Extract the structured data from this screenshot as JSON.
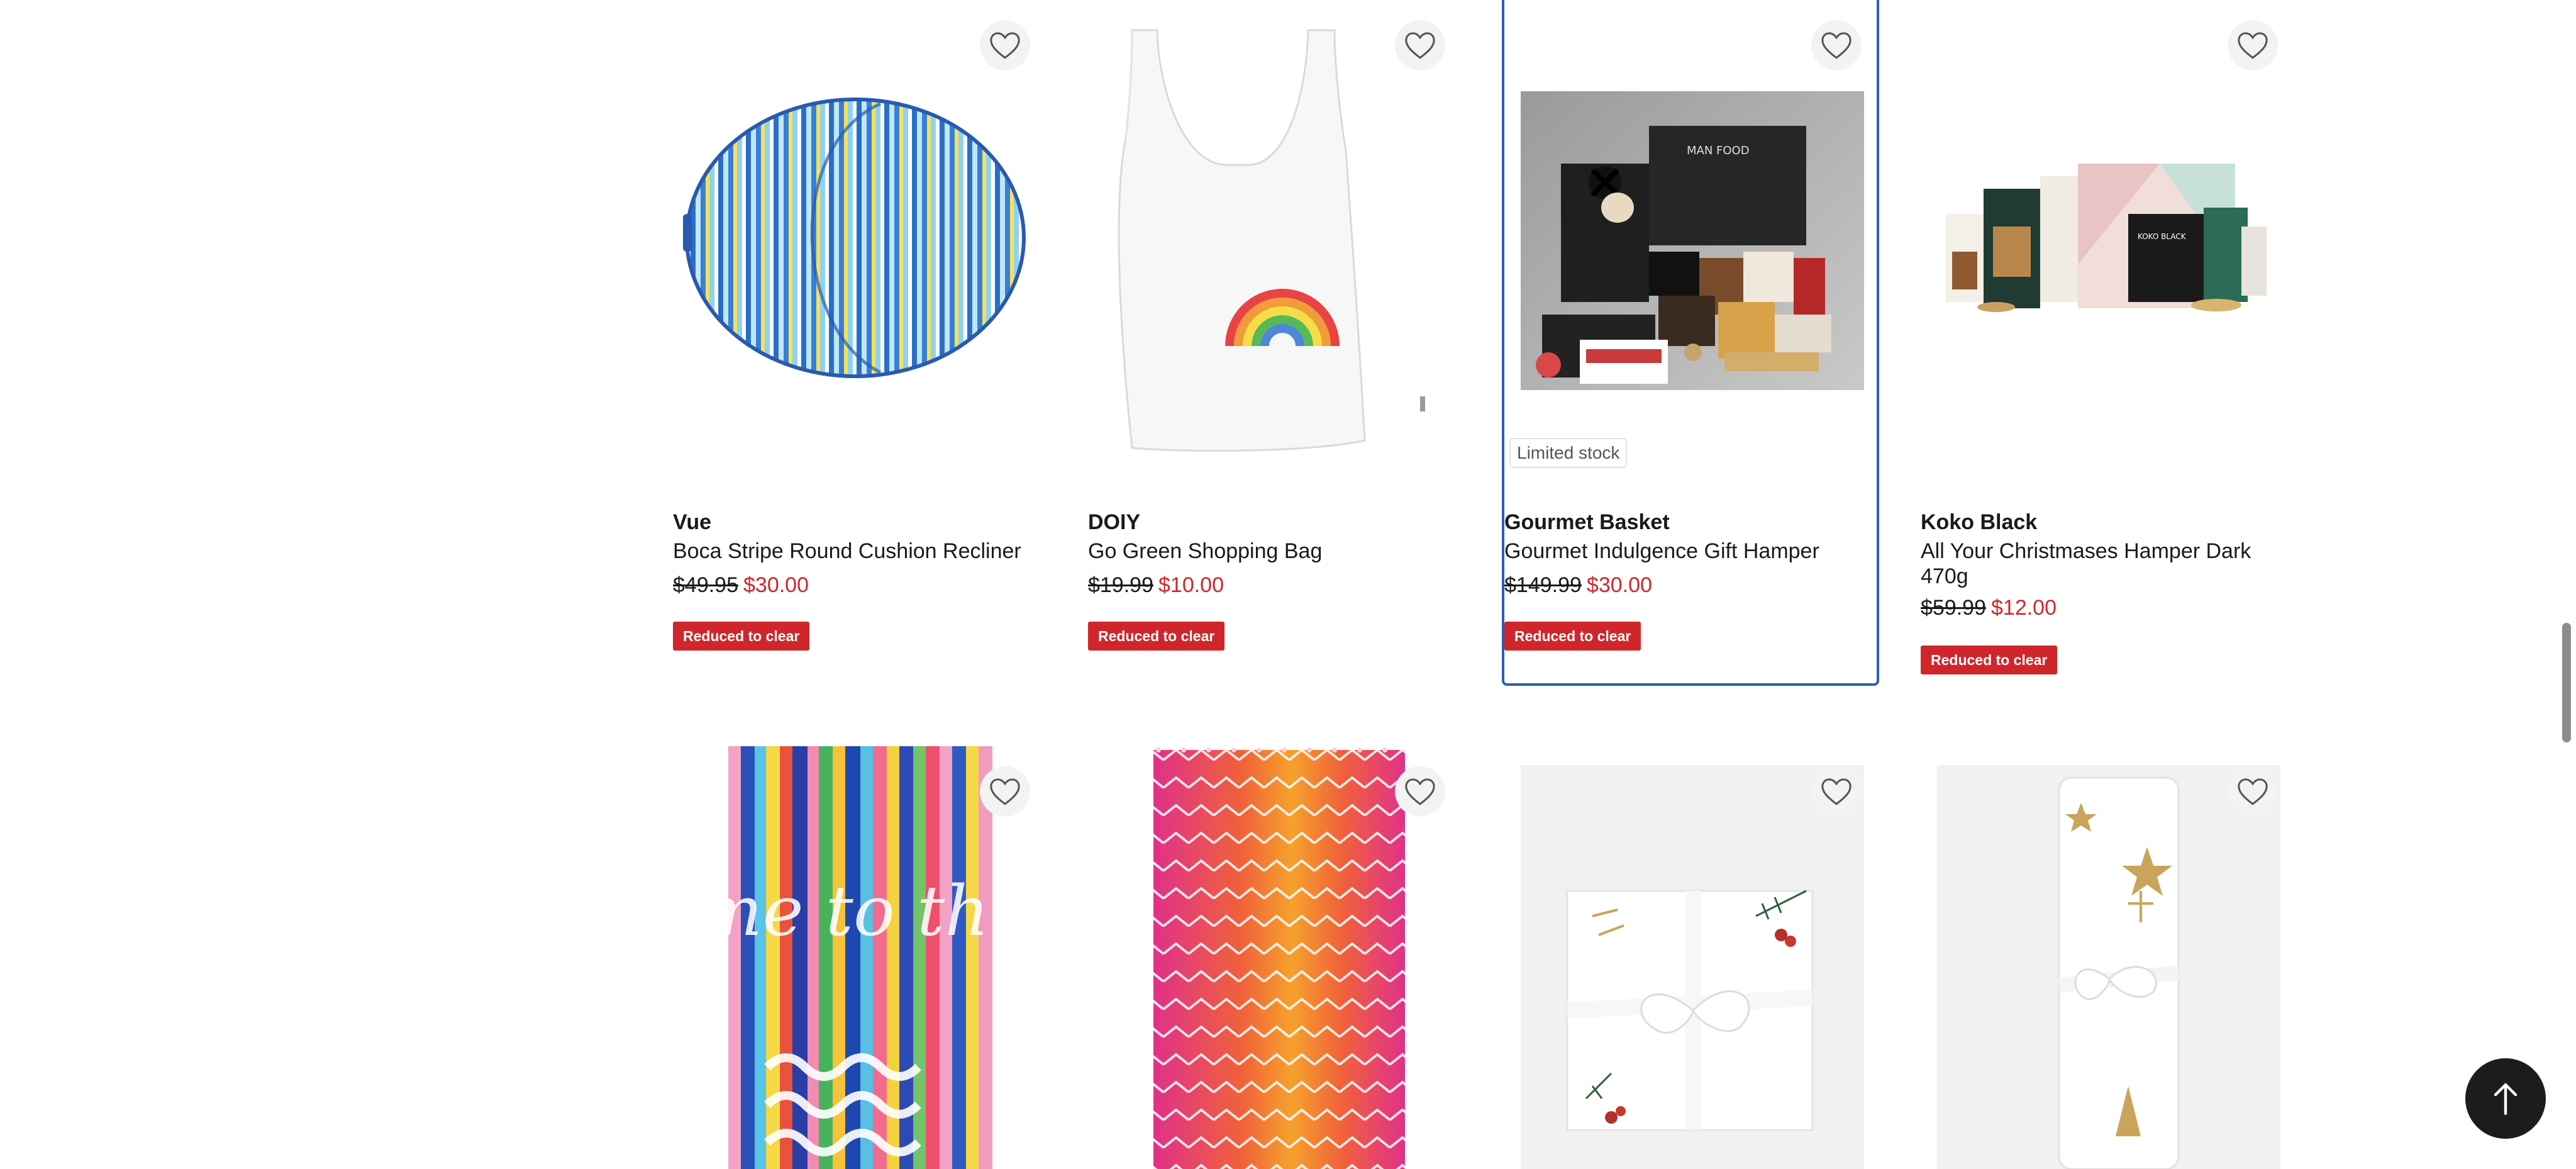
{
  "products": [
    {
      "brand": "Vue",
      "name": "Boca Stripe Round Cushion Recliner",
      "was_price": "$49.95",
      "now_price": "$30.00",
      "badge": "Reduced to clear"
    },
    {
      "brand": "DOIY",
      "name": "Go Green Shopping Bag",
      "was_price": "$19.99",
      "now_price": "$10.00",
      "badge": "Reduced to clear"
    },
    {
      "brand": "Gourmet Basket",
      "name": "Gourmet Indulgence Gift Hamper",
      "was_price": "$149.99",
      "now_price": "$30.00",
      "badge": "Reduced to clear",
      "stock_label": "Limited stock"
    },
    {
      "brand": "Koko Black",
      "name": "All Your Christmases Hamper Dark 470g",
      "was_price": "$59.99",
      "now_price": "$12.00",
      "badge": "Reduced to clear"
    }
  ],
  "beach_towel_text": "take me to the SEA",
  "icons": {
    "favourite": "heart-outline-icon",
    "back_to_top": "arrow-up-icon"
  },
  "colors": {
    "sale_red": "#d0262b",
    "selected_border": "#2a5fb0",
    "back_to_top_bg": "#1c1c1c"
  }
}
